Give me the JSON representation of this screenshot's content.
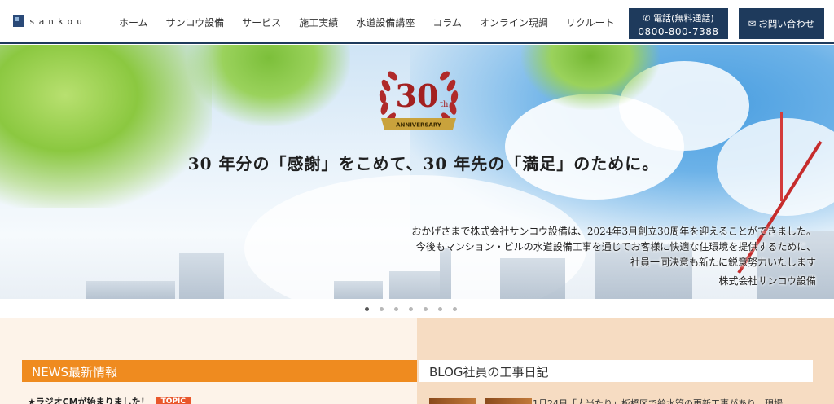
{
  "header": {
    "logo_text": "sankou",
    "nav": [
      "ホーム",
      "サンコウ設備",
      "サービス",
      "施工実績",
      "水道設備講座",
      "コラム",
      "オンライン現調",
      "リクルート"
    ],
    "tel_label": "電話(無料通話)",
    "tel_number": "0800-800-7388",
    "mail_label": "お問い合わせ",
    "accent_color": "#1e3a5c"
  },
  "hero": {
    "badge_number": "30",
    "badge_sup": "th",
    "badge_text": "ANNIVERSARY",
    "slogan": "30 年分の「感謝」をこめて、30 年先の「満足」のために。",
    "message": [
      "おかげさまで株式会社サンコウ設備は、2024年3月創立30周年を迎えることができました。",
      "今後もマンション・ビルの水道設備工事を通じてお客様に快適な住環境を提供するために、",
      "社員一同決意も新たに鋭意努力いたします"
    ],
    "signature": "株式会社サンコウ設備"
  },
  "slider": {
    "dot_count": 7,
    "active": 0
  },
  "news": {
    "title": "NEWS最新情報",
    "item_text": "★ラジオCMが始まりました！",
    "item_tag": "TOPIC",
    "accent_color": "#ef8b1f"
  },
  "blog": {
    "title": "BLOG社員の工事日記",
    "item_text": "1月24日「大当たり」板橋区で給水管の更新工事があり…現場"
  }
}
